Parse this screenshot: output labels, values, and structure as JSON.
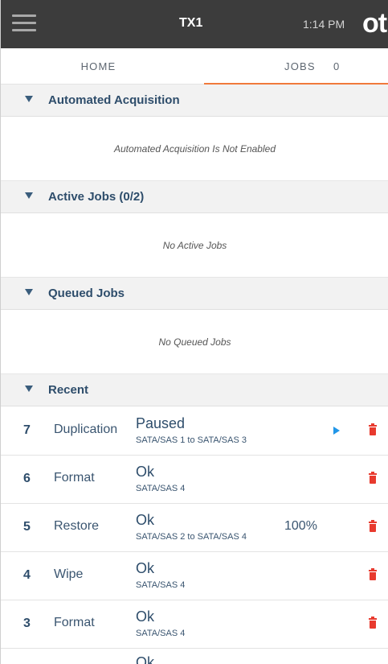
{
  "header": {
    "menu_icon": "hamburger-menu-icon",
    "title": "TX1",
    "time": "1:14 PM",
    "logo": "ot"
  },
  "tabs": {
    "home": "HOME",
    "jobs": "JOBS",
    "jobs_count": "0",
    "active": "jobs",
    "active_color": "#f07a3c"
  },
  "sections": {
    "automated": {
      "title": "Automated Acquisition",
      "message": "Automated Acquisition Is Not Enabled"
    },
    "active": {
      "title": "Active Jobs (0/2)",
      "message": "No Active Jobs"
    },
    "queued": {
      "title": "Queued Jobs",
      "message": "No Queued Jobs"
    },
    "recent": {
      "title": "Recent"
    }
  },
  "recent_jobs": [
    {
      "num": "7",
      "type": "Duplication",
      "status": "Paused",
      "detail": "SATA/SAS 1 to SATA/SAS 3",
      "progress": "",
      "icons": [
        "play-icon",
        "trash-icon"
      ]
    },
    {
      "num": "6",
      "type": "Format",
      "status": "Ok",
      "detail": "SATA/SAS 4",
      "progress": "",
      "icons": [
        "trash-icon"
      ]
    },
    {
      "num": "5",
      "type": "Restore",
      "status": "Ok",
      "detail": "SATA/SAS 2 to SATA/SAS 4",
      "progress": "100%",
      "icons": [
        "trash-icon"
      ]
    },
    {
      "num": "4",
      "type": "Wipe",
      "status": "Ok",
      "detail": "SATA/SAS 4",
      "progress": "",
      "icons": [
        "trash-icon"
      ]
    },
    {
      "num": "3",
      "type": "Format",
      "status": "Ok",
      "detail": "SATA/SAS 4",
      "progress": "",
      "icons": [
        "trash-icon"
      ]
    }
  ],
  "partial_job": {
    "status": "Ok"
  },
  "colors": {
    "topbar": "#3c3c3c",
    "accent": "#f07a3c",
    "play": "#2196e8",
    "delete": "#e83a2e",
    "section_title": "#2e4d6b"
  }
}
